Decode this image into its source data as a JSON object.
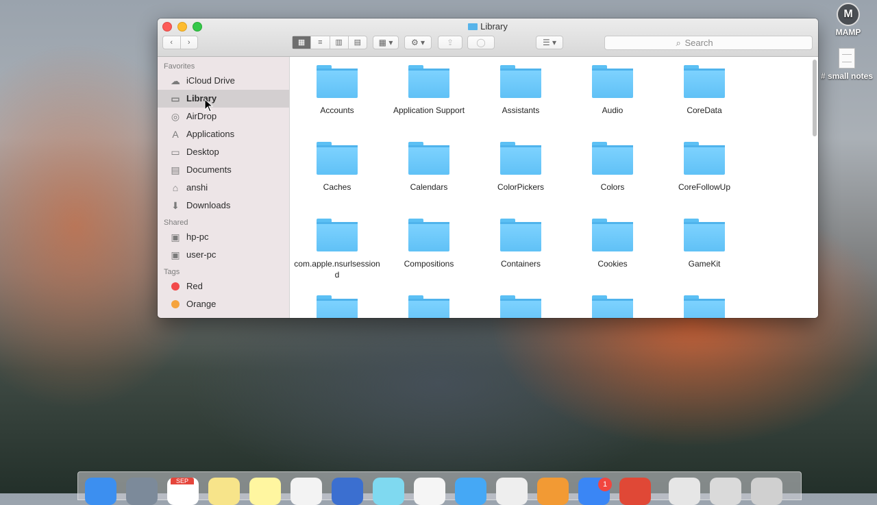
{
  "desktop": {
    "icons": [
      {
        "label": "MAMP",
        "glyph": "M"
      },
      {
        "label": "# small notes"
      }
    ]
  },
  "window": {
    "title": "Library",
    "search_placeholder": "Search"
  },
  "toolbar": {
    "back_glyph": "‹",
    "forward_glyph": "›",
    "view_modes": [
      "▦",
      "≡",
      "▥",
      "▤"
    ],
    "arrange_glyph": "▦ ▾",
    "action_glyph": "⚙ ▾",
    "share_glyph": "⇪",
    "tag_glyph": "◯",
    "sort_glyph": "☰ ▾",
    "search_glyph": "⌕"
  },
  "sidebar": {
    "favorites_header": "Favorites",
    "favorites": [
      {
        "label": "iCloud Drive",
        "icon": "cloud-icon",
        "glyph": "☁"
      },
      {
        "label": "Library",
        "icon": "folder-icon",
        "glyph": "▭"
      },
      {
        "label": "AirDrop",
        "icon": "airdrop-icon",
        "glyph": "◎"
      },
      {
        "label": "Applications",
        "icon": "applications-icon",
        "glyph": "A"
      },
      {
        "label": "Desktop",
        "icon": "desktop-icon",
        "glyph": "▭"
      },
      {
        "label": "Documents",
        "icon": "documents-icon",
        "glyph": "▤"
      },
      {
        "label": "anshi",
        "icon": "home-icon",
        "glyph": "⌂"
      },
      {
        "label": "Downloads",
        "icon": "downloads-icon",
        "glyph": "⬇"
      }
    ],
    "shared_header": "Shared",
    "shared": [
      {
        "label": "hp-pc",
        "icon": "computer-icon",
        "glyph": "▣"
      },
      {
        "label": "user-pc",
        "icon": "computer-icon",
        "glyph": "▣"
      }
    ],
    "tags_header": "Tags",
    "tags": [
      {
        "label": "Red",
        "color": "#f2494a"
      },
      {
        "label": "Orange",
        "color": "#f5a33d"
      }
    ]
  },
  "folders": [
    "Accounts",
    "Application Support",
    "Assistants",
    "Audio",
    "CoreData",
    "Caches",
    "Calendars",
    "ColorPickers",
    "Colors",
    "CoreFollowUp",
    "com.apple.nsurlsessiond",
    "Compositions",
    "Containers",
    "Cookies",
    "GameKit",
    "",
    "",
    "",
    "",
    ""
  ],
  "dock": {
    "calendar_month": "SEP",
    "app_store_badge": "1",
    "icon_colors": [
      "#3c8ff0",
      "#7c8a9a",
      "#ffffff",
      "#f7e48a",
      "#fff6a0",
      "#f3f3f3",
      "#3b6fd0",
      "#7fd9f0",
      "#f5f5f5",
      "#45a8f5",
      "#eeeeee",
      "#f29a34",
      "#3a86f5",
      "#e04836",
      "#e6e6e6",
      "#dadada",
      "#d0d0d0"
    ]
  }
}
